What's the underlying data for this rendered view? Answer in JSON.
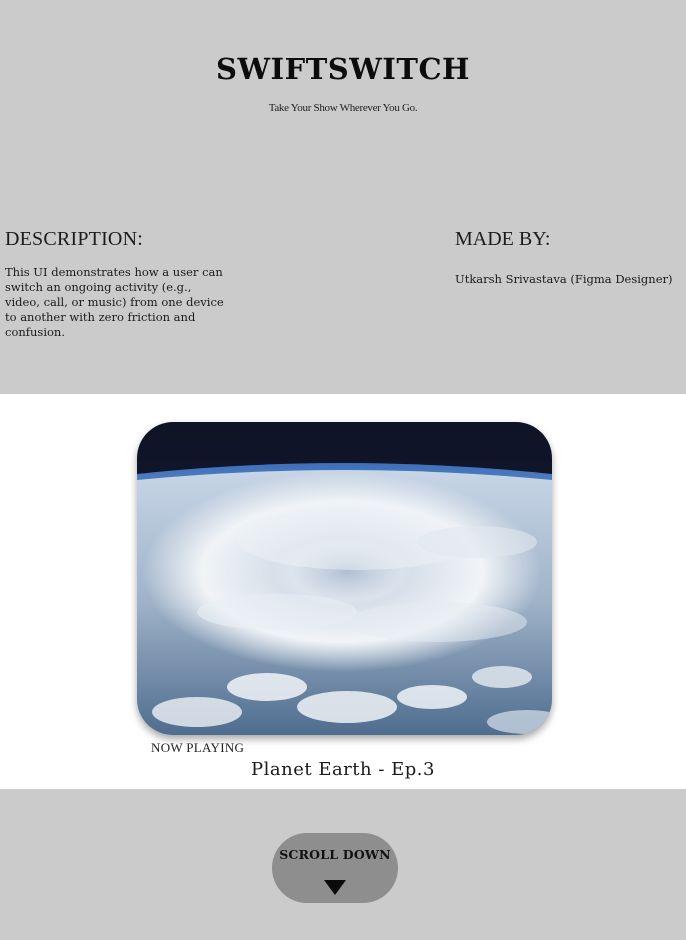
{
  "header": {
    "brand": "SWIFTSWITCH",
    "tagline": "Take Your Show Wherever You Go."
  },
  "description": {
    "title": "DESCRIPTION:",
    "text": "This UI demonstrates how a user can switch an ongoing activity (e.g., video, call, or music) from one device to another with zero friction and confusion."
  },
  "credits": {
    "title": "MADE BY:",
    "text": "Utkarsh Srivastava (Figma Designer)"
  },
  "player": {
    "artwork_icon": "earth-from-space-image",
    "now_playing_label": "NOW PLAYING",
    "track_title": "Planet Earth - Ep.3"
  },
  "footer": {
    "scroll_label": "SCROLL DOWN",
    "scroll_icon": "triangle-down-icon"
  },
  "colors": {
    "background": "#cbcbcb",
    "player_background": "#ffffff",
    "button": "#8e8e8e",
    "text": "#111111"
  }
}
